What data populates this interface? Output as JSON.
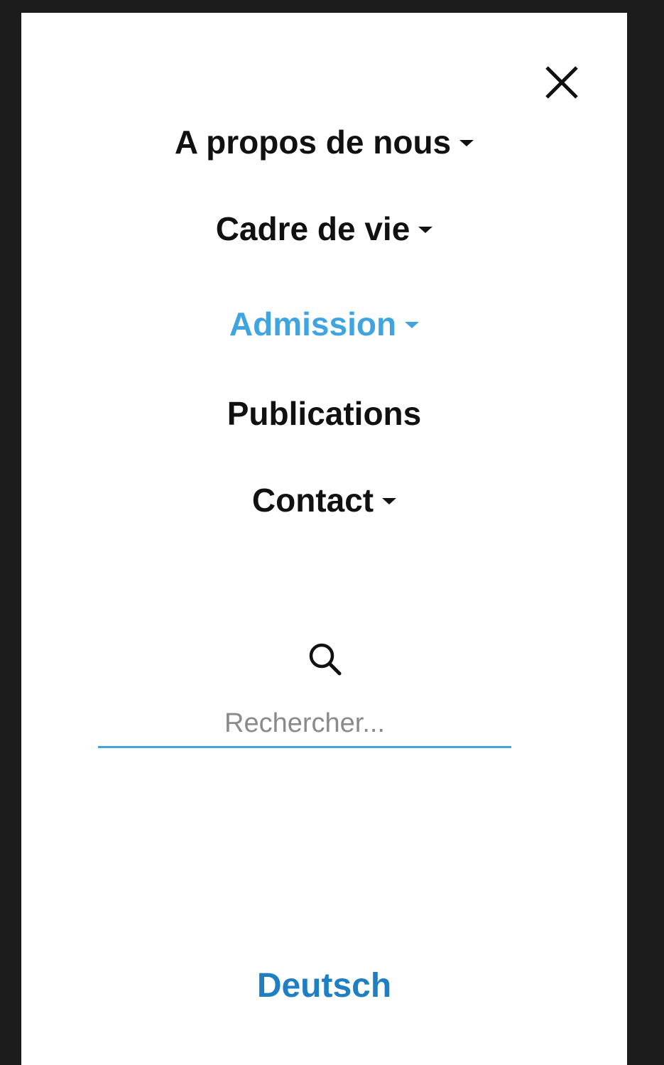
{
  "menu": {
    "close_icon": "close-icon",
    "items": [
      {
        "label": "A propos de nous",
        "has_dropdown": true,
        "active": false
      },
      {
        "label": "Cadre de vie",
        "has_dropdown": true,
        "active": false
      },
      {
        "label": "Admission",
        "has_dropdown": true,
        "active": true
      },
      {
        "label": "Publications",
        "has_dropdown": false,
        "active": false
      },
      {
        "label": "Contact",
        "has_dropdown": true,
        "active": false
      }
    ]
  },
  "search": {
    "icon": "search-icon",
    "placeholder": "Rechercher...",
    "value": ""
  },
  "language": {
    "label": "Deutsch"
  },
  "colors": {
    "accent": "#3fa4e0",
    "link": "#1f7fc3",
    "text": "#111111",
    "background": "#ffffff",
    "outer": "#1c1c1c"
  }
}
